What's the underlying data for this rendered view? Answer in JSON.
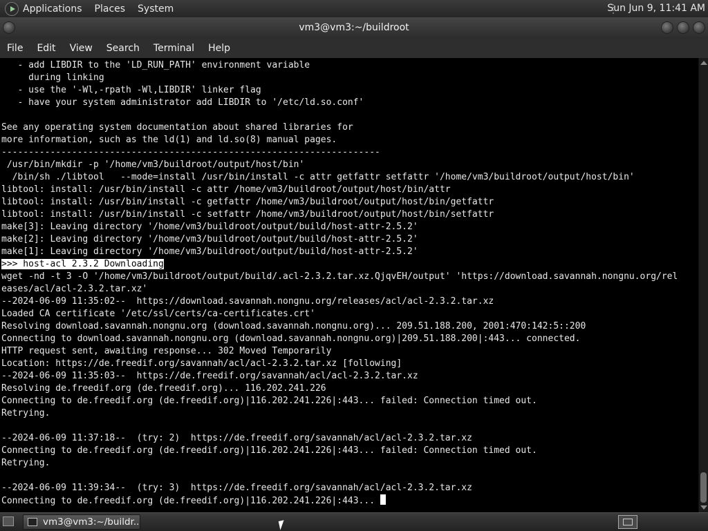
{
  "top_panel": {
    "menus": [
      "Applications",
      "Places",
      "System"
    ],
    "clock": "Sun Jun  9, 11:41 AM"
  },
  "window": {
    "title": "vm3@vm3:~/buildroot"
  },
  "menubar": {
    "items": [
      "File",
      "Edit",
      "View",
      "Search",
      "Terminal",
      "Help"
    ]
  },
  "terminal": {
    "lines": [
      "   - add LIBDIR to the 'LD_RUN_PATH' environment variable",
      "     during linking",
      "   - use the '-Wl,-rpath -Wl,LIBDIR' linker flag",
      "   - have your system administrator add LIBDIR to '/etc/ld.so.conf'",
      "",
      "See any operating system documentation about shared libraries for",
      "more information, such as the ld(1) and ld.so(8) manual pages.",
      "----------------------------------------------------------------------",
      " /usr/bin/mkdir -p '/home/vm3/buildroot/output/host/bin'",
      "  /bin/sh ./libtool   --mode=install /usr/bin/install -c attr getfattr setfattr '/home/vm3/buildroot/output/host/bin'",
      "libtool: install: /usr/bin/install -c attr /home/vm3/buildroot/output/host/bin/attr",
      "libtool: install: /usr/bin/install -c getfattr /home/vm3/buildroot/output/host/bin/getfattr",
      "libtool: install: /usr/bin/install -c setfattr /home/vm3/buildroot/output/host/bin/setfattr",
      "make[3]: Leaving directory '/home/vm3/buildroot/output/build/host-attr-2.5.2'",
      "make[2]: Leaving directory '/home/vm3/buildroot/output/build/host-attr-2.5.2'",
      "make[1]: Leaving directory '/home/vm3/buildroot/output/build/host-attr-2.5.2'",
      ">>> host-acl 2.3.2 Downloading",
      "wget -nd -t 3 -O '/home/vm3/buildroot/output/build/.acl-2.3.2.tar.xz.QjqvEH/output' 'https://download.savannah.nongnu.org/rel",
      "eases/acl/acl-2.3.2.tar.xz'",
      "--2024-06-09 11:35:02--  https://download.savannah.nongnu.org/releases/acl/acl-2.3.2.tar.xz",
      "Loaded CA certificate '/etc/ssl/certs/ca-certificates.crt'",
      "Resolving download.savannah.nongnu.org (download.savannah.nongnu.org)... 209.51.188.200, 2001:470:142:5::200",
      "Connecting to download.savannah.nongnu.org (download.savannah.nongnu.org)|209.51.188.200|:443... connected.",
      "HTTP request sent, awaiting response... 302 Moved Temporarily",
      "Location: https://de.freedif.org/savannah/acl/acl-2.3.2.tar.xz [following]",
      "--2024-06-09 11:35:03--  https://de.freedif.org/savannah/acl/acl-2.3.2.tar.xz",
      "Resolving de.freedif.org (de.freedif.org)... 116.202.241.226",
      "Connecting to de.freedif.org (de.freedif.org)|116.202.241.226|:443... failed: Connection timed out.",
      "Retrying.",
      "",
      "--2024-06-09 11:37:18--  (try: 2)  https://de.freedif.org/savannah/acl/acl-2.3.2.tar.xz",
      "Connecting to de.freedif.org (de.freedif.org)|116.202.241.226|:443... failed: Connection timed out.",
      "Retrying.",
      "",
      "--2024-06-09 11:39:34--  (try: 3)  https://de.freedif.org/savannah/acl/acl-2.3.2.tar.xz",
      "Connecting to de.freedif.org (de.freedif.org)|116.202.241.226|:443... "
    ],
    "highlighted_line_index": 16
  },
  "taskbar": {
    "task_label": "vm3@vm3:~/buildr..."
  }
}
